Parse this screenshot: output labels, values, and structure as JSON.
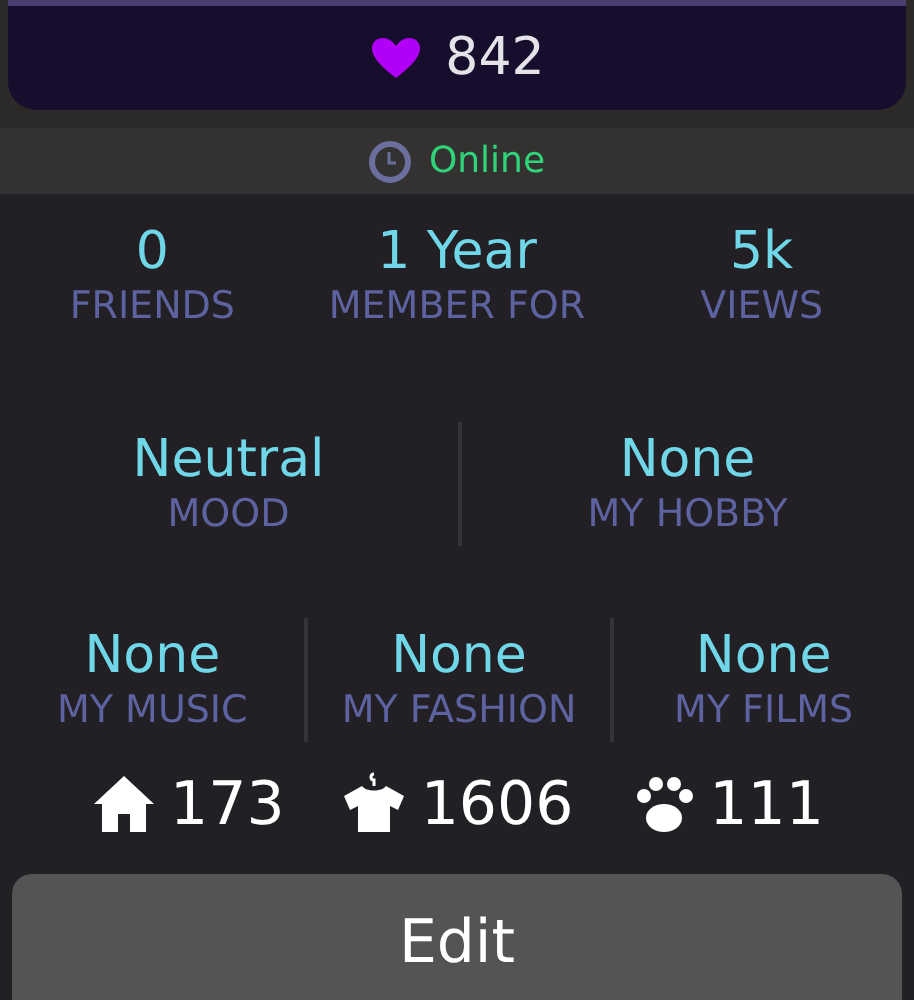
{
  "likes": "842",
  "status": "Online",
  "stats": [
    {
      "value": "0",
      "label": "FRIENDS"
    },
    {
      "value": "1 Year",
      "label": "MEMBER FOR"
    },
    {
      "value": "5k",
      "label": "VIEWS"
    }
  ],
  "mood_row": [
    {
      "value": "Neutral",
      "label": "MOOD"
    },
    {
      "value": "None",
      "label": "MY HOBBY"
    }
  ],
  "favorites_row": [
    {
      "value": "None",
      "label": "MY MUSIC"
    },
    {
      "value": "None",
      "label": "MY FASHION"
    },
    {
      "value": "None",
      "label": "MY FILMS"
    }
  ],
  "counters": [
    {
      "kind": "house",
      "count": "173"
    },
    {
      "kind": "shirt",
      "count": "1606"
    },
    {
      "kind": "paw",
      "count": "111"
    }
  ],
  "button": "Edit"
}
